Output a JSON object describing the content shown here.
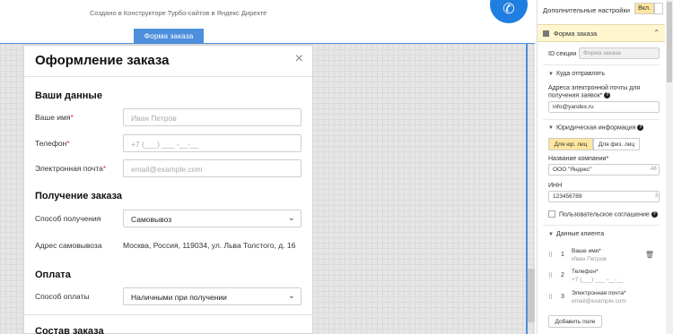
{
  "header": {
    "created_text": "Создано в Конструкторе Турбо-сайтов в Яндекс Директе",
    "form_tag": "Форма заказа",
    "phone_icon": "phone-icon"
  },
  "modal": {
    "title": "Оформление заказа",
    "close_icon": "×",
    "section_contacts": "Ваши данные",
    "name_label": "Ваше имя",
    "name_placeholder": "Иван Петров",
    "phone_label": "Телефон",
    "phone_placeholder": "+7 (___) ___ -__-__",
    "email_label": "Электронная почта",
    "email_placeholder": "email@example.com",
    "required_mark": "*",
    "section_delivery": "Получение заказа",
    "method_label": "Способ получения",
    "method_value": "Самовывоз",
    "address_label": "Адрес самовывоза",
    "address_value": "Москва, Россия, 119034, ул. Льва Толстого, д. 16",
    "section_payment": "Оплата",
    "pay_label": "Способ оплаты",
    "pay_value": "Наличными при получении",
    "section_order": "Состав заказа",
    "chevron": "⌄"
  },
  "panel": {
    "extra_settings": "Дополнительные настройки",
    "toggle_on": "Вкл.",
    "form_header": "Форма заказа",
    "collapse": "⌃",
    "section_id_label": "ID секции",
    "section_id_placeholder": "Форма заказа",
    "send_to": "Куда отправлять",
    "email_desc_1": "Адреса электронной почты для",
    "email_desc_2": "получения заявок",
    "email_value": "info@yandex.ru",
    "legal_info": "Юридическая информация",
    "tab_legal": "Для юр. лиц",
    "tab_individual": "Для физ. лиц",
    "company_label": "Название компании",
    "company_value": "ООО \"Яндекс\"",
    "company_count": "48",
    "inn_label": "ИНН",
    "inn_value": "123456789",
    "inn_count": "3",
    "agreement": "Пользовательское соглашение",
    "client_data": "Данные клиента",
    "fields": [
      {
        "num": "1",
        "name": "Ваше имя*",
        "hint": "Иван Петров"
      },
      {
        "num": "2",
        "name": "Телефон*",
        "hint": "+7 (___) ___ -__-__"
      },
      {
        "num": "3",
        "name": "Электронная почта*",
        "hint": "email@example.com"
      }
    ],
    "add_field": "Добавить поле",
    "required_mark": "*",
    "help": "?"
  }
}
